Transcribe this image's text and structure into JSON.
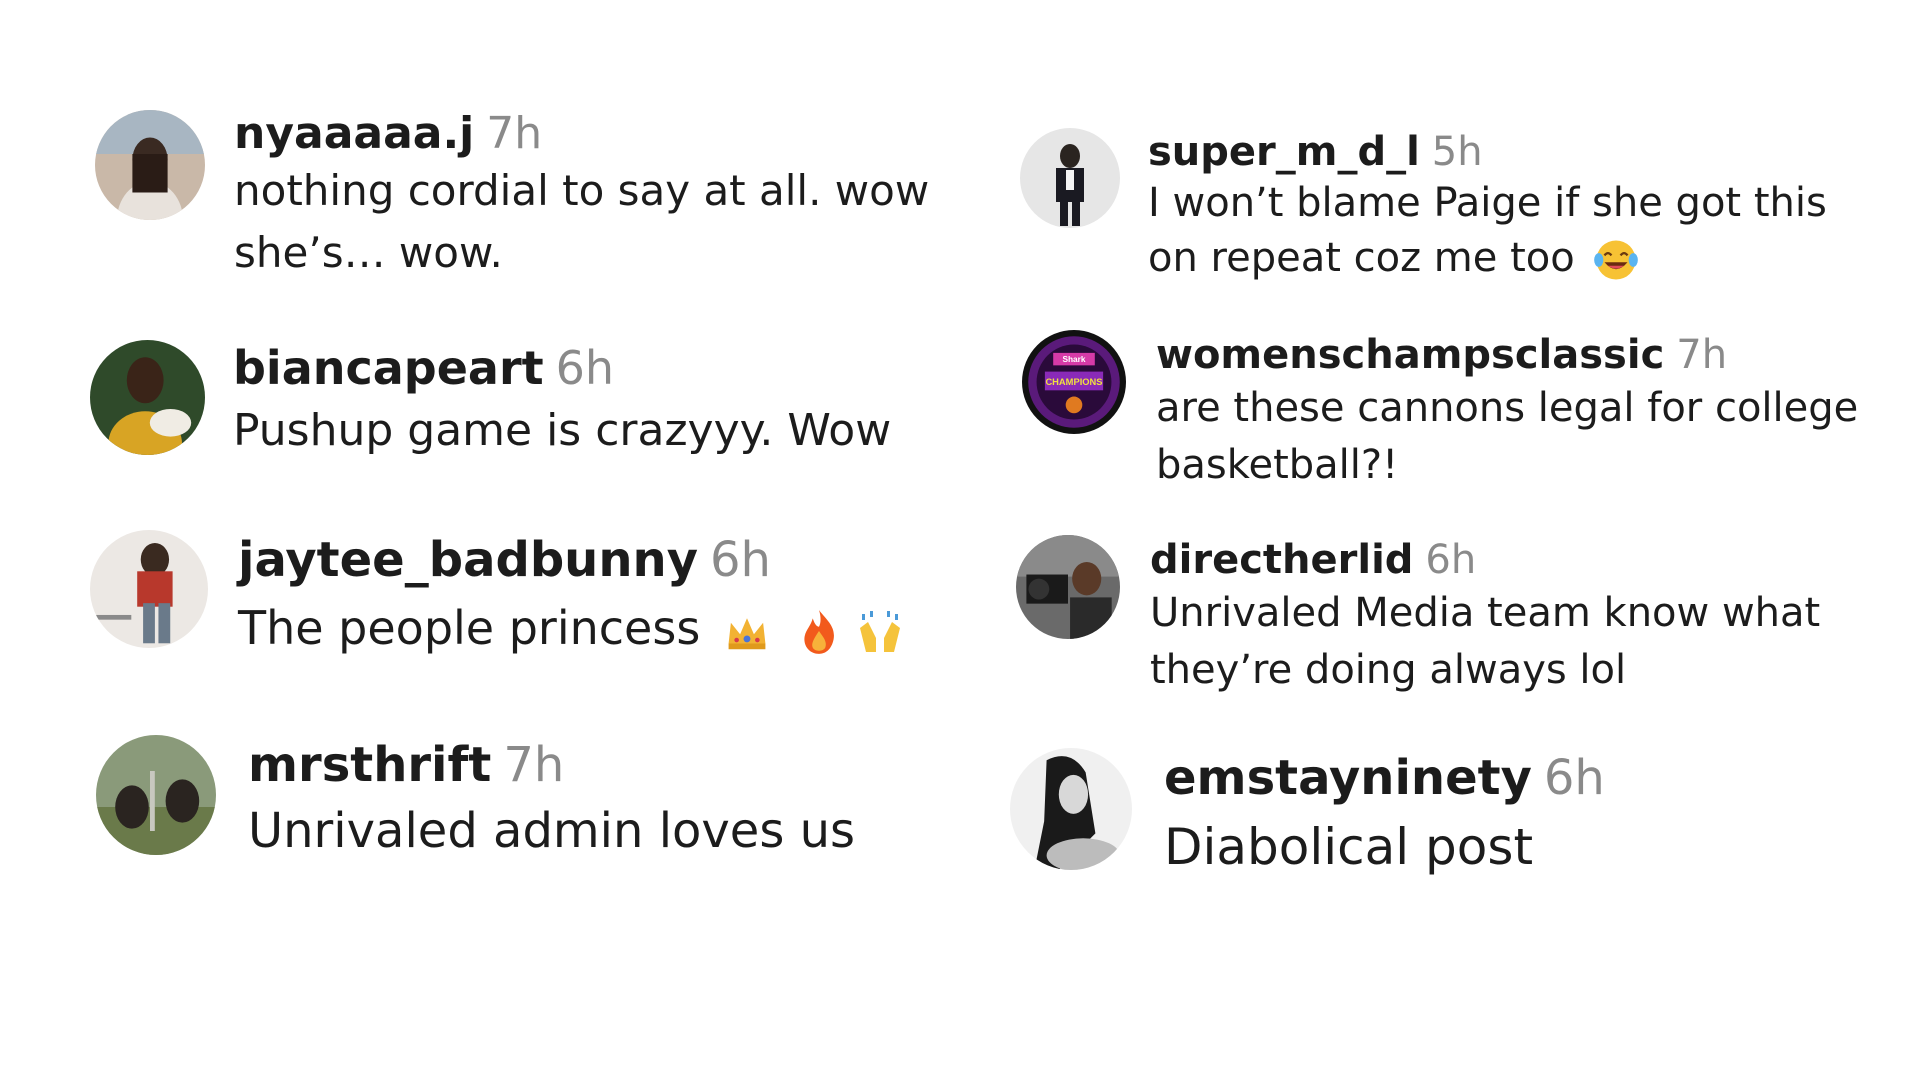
{
  "comments": [
    {
      "username": "nyaaaaa.j",
      "time": "7h",
      "text": "nothing cordial to say at all. wow she’s… wow."
    },
    {
      "username": "biancapeart",
      "time": "6h",
      "text": "Pushup game is crazyyy. Wow"
    },
    {
      "username": "jaytee_badbunny",
      "time": "6h",
      "text": "The people princess",
      "emojis": [
        "crown-emoji",
        "fire-emoji",
        "raising-hands-emoji"
      ]
    },
    {
      "username": "mrsthrift",
      "time": "7h",
      "text": "Unrivaled admin loves us"
    },
    {
      "username": "super_m_d_l",
      "time": "5h",
      "text": "I won’t blame Paige if she got this on repeat coz me too",
      "emojis": [
        "tears-of-joy-emoji"
      ]
    },
    {
      "username": "womenschampsclassic",
      "time": "7h",
      "text": "are these cannons legal for college basketball?!",
      "avatar_logo_text": [
        "Shark",
        "CHAMPIONS"
      ]
    },
    {
      "username": "directherlid",
      "time": "6h",
      "text": "Unrivaled Media team know what they’re doing always lol"
    },
    {
      "username": "emstayninety",
      "time": "6h",
      "text": "Diabolical post"
    }
  ],
  "colors": {
    "username": "#1c1c1c",
    "timestamp": "#8a8a8a",
    "text": "#1c1c1c",
    "background": "#ffffff"
  }
}
